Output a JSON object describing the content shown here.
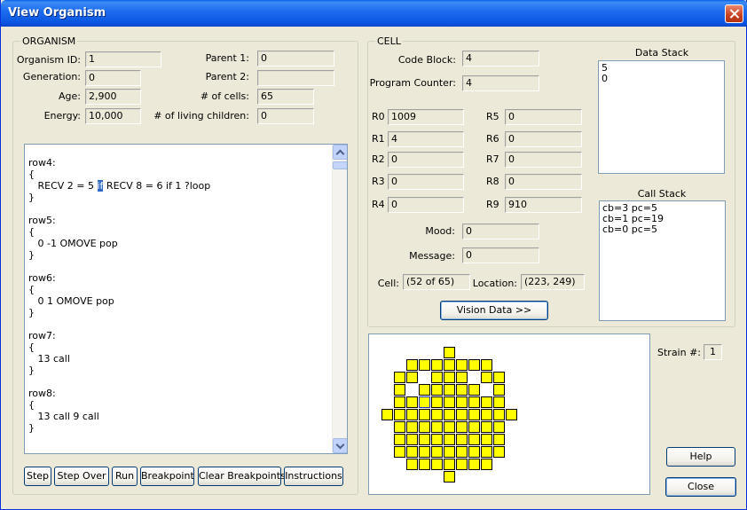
{
  "window": {
    "title": "View Organism"
  },
  "organism": {
    "group_title": "ORGANISM",
    "fields": {
      "organism_id": {
        "label": "Organism ID:",
        "value": "1"
      },
      "generation": {
        "label": "Generation:",
        "value": "0"
      },
      "age": {
        "label": "Age:",
        "value": "2,900"
      },
      "energy": {
        "label": "Energy:",
        "value": "10,000"
      },
      "parent1": {
        "label": "Parent 1:",
        "value": "0"
      },
      "parent2": {
        "label": "Parent 2:",
        "value": ""
      },
      "num_cells": {
        "label": "# of cells:",
        "value": "65"
      },
      "living_children": {
        "label": "# of living children:",
        "value": "0"
      }
    }
  },
  "code": {
    "lines": [
      "row4:",
      "{",
      "   RECV 2 = 5 ",
      "}",
      "",
      "row5:",
      "{",
      "   0 -1 OMOVE pop",
      "}",
      "",
      "row6:",
      "{",
      "   0 1 OMOVE pop",
      "}",
      "",
      "row7:",
      "{",
      "   13 call",
      "}",
      "",
      "row8:",
      "{",
      "   13 call 9 call",
      "}"
    ],
    "caret_char": "if",
    "caret_rest": " RECV 8 = 6 if 1 ?loop"
  },
  "buttons": {
    "step": "Step",
    "step_over": "Step Over",
    "run": "Run",
    "breakpoint": "Breakpoint",
    "clear_breakpoints": "Clear Breakpoints",
    "instructions": "Instructions",
    "vision_data": "Vision Data >>",
    "help": "Help",
    "close": "Close"
  },
  "cell": {
    "group_title": "CELL",
    "code_block": {
      "label": "Code Block:",
      "value": "4"
    },
    "program_counter": {
      "label": "Program Counter:",
      "value": "4"
    },
    "registers": [
      {
        "label": "R0",
        "value": "1009"
      },
      {
        "label": "R1",
        "value": "4"
      },
      {
        "label": "R2",
        "value": "0"
      },
      {
        "label": "R3",
        "value": "0"
      },
      {
        "label": "R4",
        "value": "0"
      },
      {
        "label": "R5",
        "value": "0"
      },
      {
        "label": "R6",
        "value": "0"
      },
      {
        "label": "R7",
        "value": "0"
      },
      {
        "label": "R8",
        "value": "0"
      },
      {
        "label": "R9",
        "value": "910"
      }
    ],
    "mood": {
      "label": "Mood:",
      "value": "0"
    },
    "message": {
      "label": "Message:",
      "value": "0"
    },
    "cell_index": {
      "label": "Cell:",
      "value": "(52 of 65)"
    },
    "location": {
      "label": "Location:",
      "value": "(223, 249)"
    },
    "data_stack": {
      "title": "Data Stack",
      "items": [
        "5",
        "0"
      ]
    },
    "call_stack": {
      "title": "Call Stack",
      "items": [
        "cb=3 pc=5",
        "cb=1 pc=19",
        "cb=0 pc=5"
      ]
    }
  },
  "strain": {
    "label": "Strain #:",
    "value": "1"
  },
  "colors": {
    "cell_fill": "#ffff00",
    "cell_border": "#000000",
    "selected_cell_outline": "#2030c0"
  }
}
